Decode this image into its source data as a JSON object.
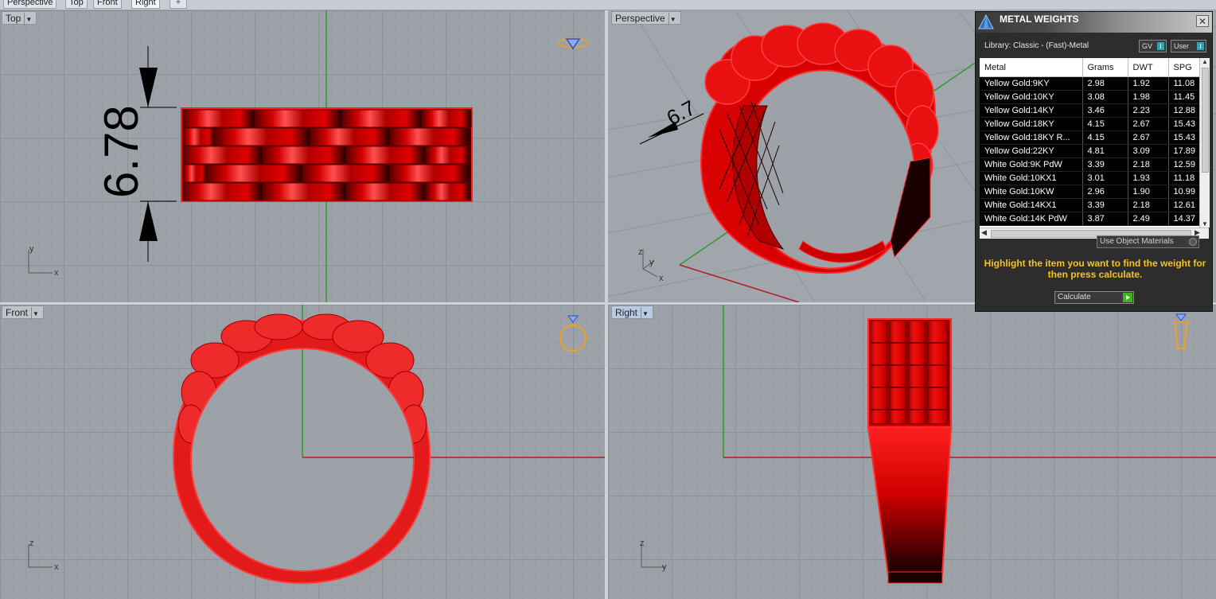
{
  "tabs": {
    "items": [
      "Perspective",
      "Top",
      "Front",
      "Right"
    ],
    "active": "Right",
    "add_icon": "plus-icon"
  },
  "viewports": {
    "top": {
      "label": "Top",
      "dimension": "6.78",
      "axes": [
        "y",
        "x"
      ]
    },
    "perspective": {
      "label": "Perspective",
      "dimension_partial": "6.7",
      "axes": [
        "z",
        "y",
        "x"
      ]
    },
    "front": {
      "label": "Front",
      "axes": [
        "z",
        "x"
      ]
    },
    "right": {
      "label": "Right",
      "axes": [
        "z",
        "y"
      ]
    }
  },
  "panel": {
    "title": "METAL WEIGHTS",
    "library": "Library: Classic - (Fast)-Metal",
    "toggle_gv": "GV",
    "toggle_user": "User",
    "columns": [
      "Metal",
      "Grams",
      "DWT",
      "SPG"
    ],
    "rows": [
      [
        "Yellow Gold:9KY",
        "2.98",
        "1.92",
        "11.08"
      ],
      [
        "Yellow Gold:10KY",
        "3.08",
        "1.98",
        "11.45"
      ],
      [
        "Yellow Gold:14KY",
        "3.46",
        "2.23",
        "12.88"
      ],
      [
        "Yellow Gold:18KY",
        "4.15",
        "2.67",
        "15.43"
      ],
      [
        "Yellow Gold:18KY R...",
        "4.15",
        "2.67",
        "15.43"
      ],
      [
        "Yellow Gold:22KY",
        "4.81",
        "3.09",
        "17.89"
      ],
      [
        "White Gold:9K PdW",
        "3.39",
        "2.18",
        "12.59"
      ],
      [
        "White Gold:10KX1",
        "3.01",
        "1.93",
        "11.18"
      ],
      [
        "White Gold:10KW",
        "2.96",
        "1.90",
        "10.99"
      ],
      [
        "White Gold:14KX1",
        "3.39",
        "2.18",
        "12.61"
      ],
      [
        "White Gold:14K PdW",
        "3.87",
        "2.49",
        "14.37"
      ]
    ],
    "use_object_materials": "Use Object Materials",
    "message": "Highlight the item you want to find the weight for then press calculate.",
    "calculate_label": "Calculate",
    "accent_color": "#f5c320",
    "selection_color": "#cc0000"
  }
}
